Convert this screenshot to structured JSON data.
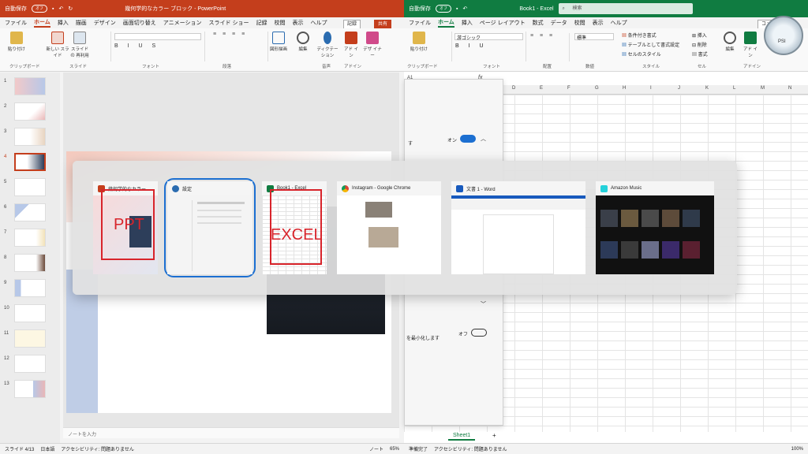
{
  "ppt": {
    "autosave_label": "自動保存",
    "autosave_state": "オフ",
    "window_title": "幾何学的なカラー ブロック  -  PowerPoint",
    "record_label": "記録",
    "share_label": "共有",
    "tabs": [
      "ファイル",
      "ホーム",
      "挿入",
      "描画",
      "デザイン",
      "画面切り替え",
      "アニメーション",
      "スライド ショー",
      "記録",
      "校閲",
      "表示",
      "ヘルプ"
    ],
    "active_tab": "ホーム",
    "ribbon": {
      "paste": "貼り付け",
      "new_slide": "新しい\nスライド",
      "reuse_slide": "スライドの\n再利用",
      "shapes": "図形描画",
      "edit": "編集",
      "dictate": "ディクテー\nション",
      "designer": "アド\nイン",
      "design_ideas": "デザ\nイナー",
      "groups": [
        "クリップボード",
        "スライド",
        "フォント",
        "段落",
        "音声",
        "アドイン"
      ]
    },
    "slide_numbers": [
      "1",
      "2",
      "3",
      "4",
      "5",
      "6",
      "7",
      "8",
      "9",
      "10",
      "11",
      "12",
      "13"
    ],
    "selected_slide": "4",
    "notes_placeholder": "ノートを入力",
    "status": {
      "slide": "スライド 4/13",
      "lang": "日本語",
      "accessibility": "アクセシビリティ: 問題ありません",
      "notes": "ノート",
      "zoom": "65%"
    }
  },
  "excel": {
    "autosave_label": "自動保存",
    "autosave_state": "オフ",
    "window_title": "Book1  -  Excel",
    "search_placeholder": "検索",
    "comment_label": "コメント",
    "tabs": [
      "ファイル",
      "ホーム",
      "挿入",
      "ページ レイアウト",
      "数式",
      "データ",
      "校閲",
      "表示",
      "ヘルプ"
    ],
    "active_tab": "ホーム",
    "font_name": "游ゴシック",
    "number_format": "標準",
    "ribbon": {
      "paste": "貼り付け",
      "cond_format": "条件付き書式",
      "table_format": "テーブルとして書式設定",
      "cell_style": "セルのスタイル",
      "insert": "挿入",
      "delete": "削除",
      "format": "書式",
      "edit": "編集",
      "addin": "アド\nイン",
      "groups": [
        "クリップボード",
        "フォント",
        "配置",
        "数値",
        "スタイル",
        "セル",
        "アドイン"
      ]
    },
    "name_box": "A1",
    "fx": "fx",
    "columns": [
      "D",
      "E",
      "F",
      "G",
      "H",
      "I",
      "J",
      "K",
      "L",
      "M",
      "N"
    ],
    "sheet_tab": "Sheet1",
    "status": {
      "ready": "準備完了",
      "accessibility": "アクセシビリティ: 問題ありません",
      "zoom": "100%"
    }
  },
  "settings_bg": {
    "on_label": "オン",
    "off_label": "オフ",
    "text_fragment": "を最小化します",
    "partial_label": "す"
  },
  "switcher": {
    "cards": [
      {
        "title": "幾何学的なカラー...",
        "overlay": "PPT",
        "icon_color": "#c43e1c"
      },
      {
        "title": "設定",
        "icon_color": "#2b6cb0"
      },
      {
        "title": "Book1 - Excel",
        "overlay": "EXCEL",
        "icon_color": "#107c41"
      },
      {
        "title": "Instagram - Google Chrome",
        "icon_color": "#e8a317"
      },
      {
        "title": "文書 1 - Word",
        "icon_color": "#185abd"
      },
      {
        "title": "Amazon Music",
        "icon_color": "#25d1da"
      }
    ],
    "selected_index": 1
  },
  "gauge": {
    "label": "PSI"
  }
}
